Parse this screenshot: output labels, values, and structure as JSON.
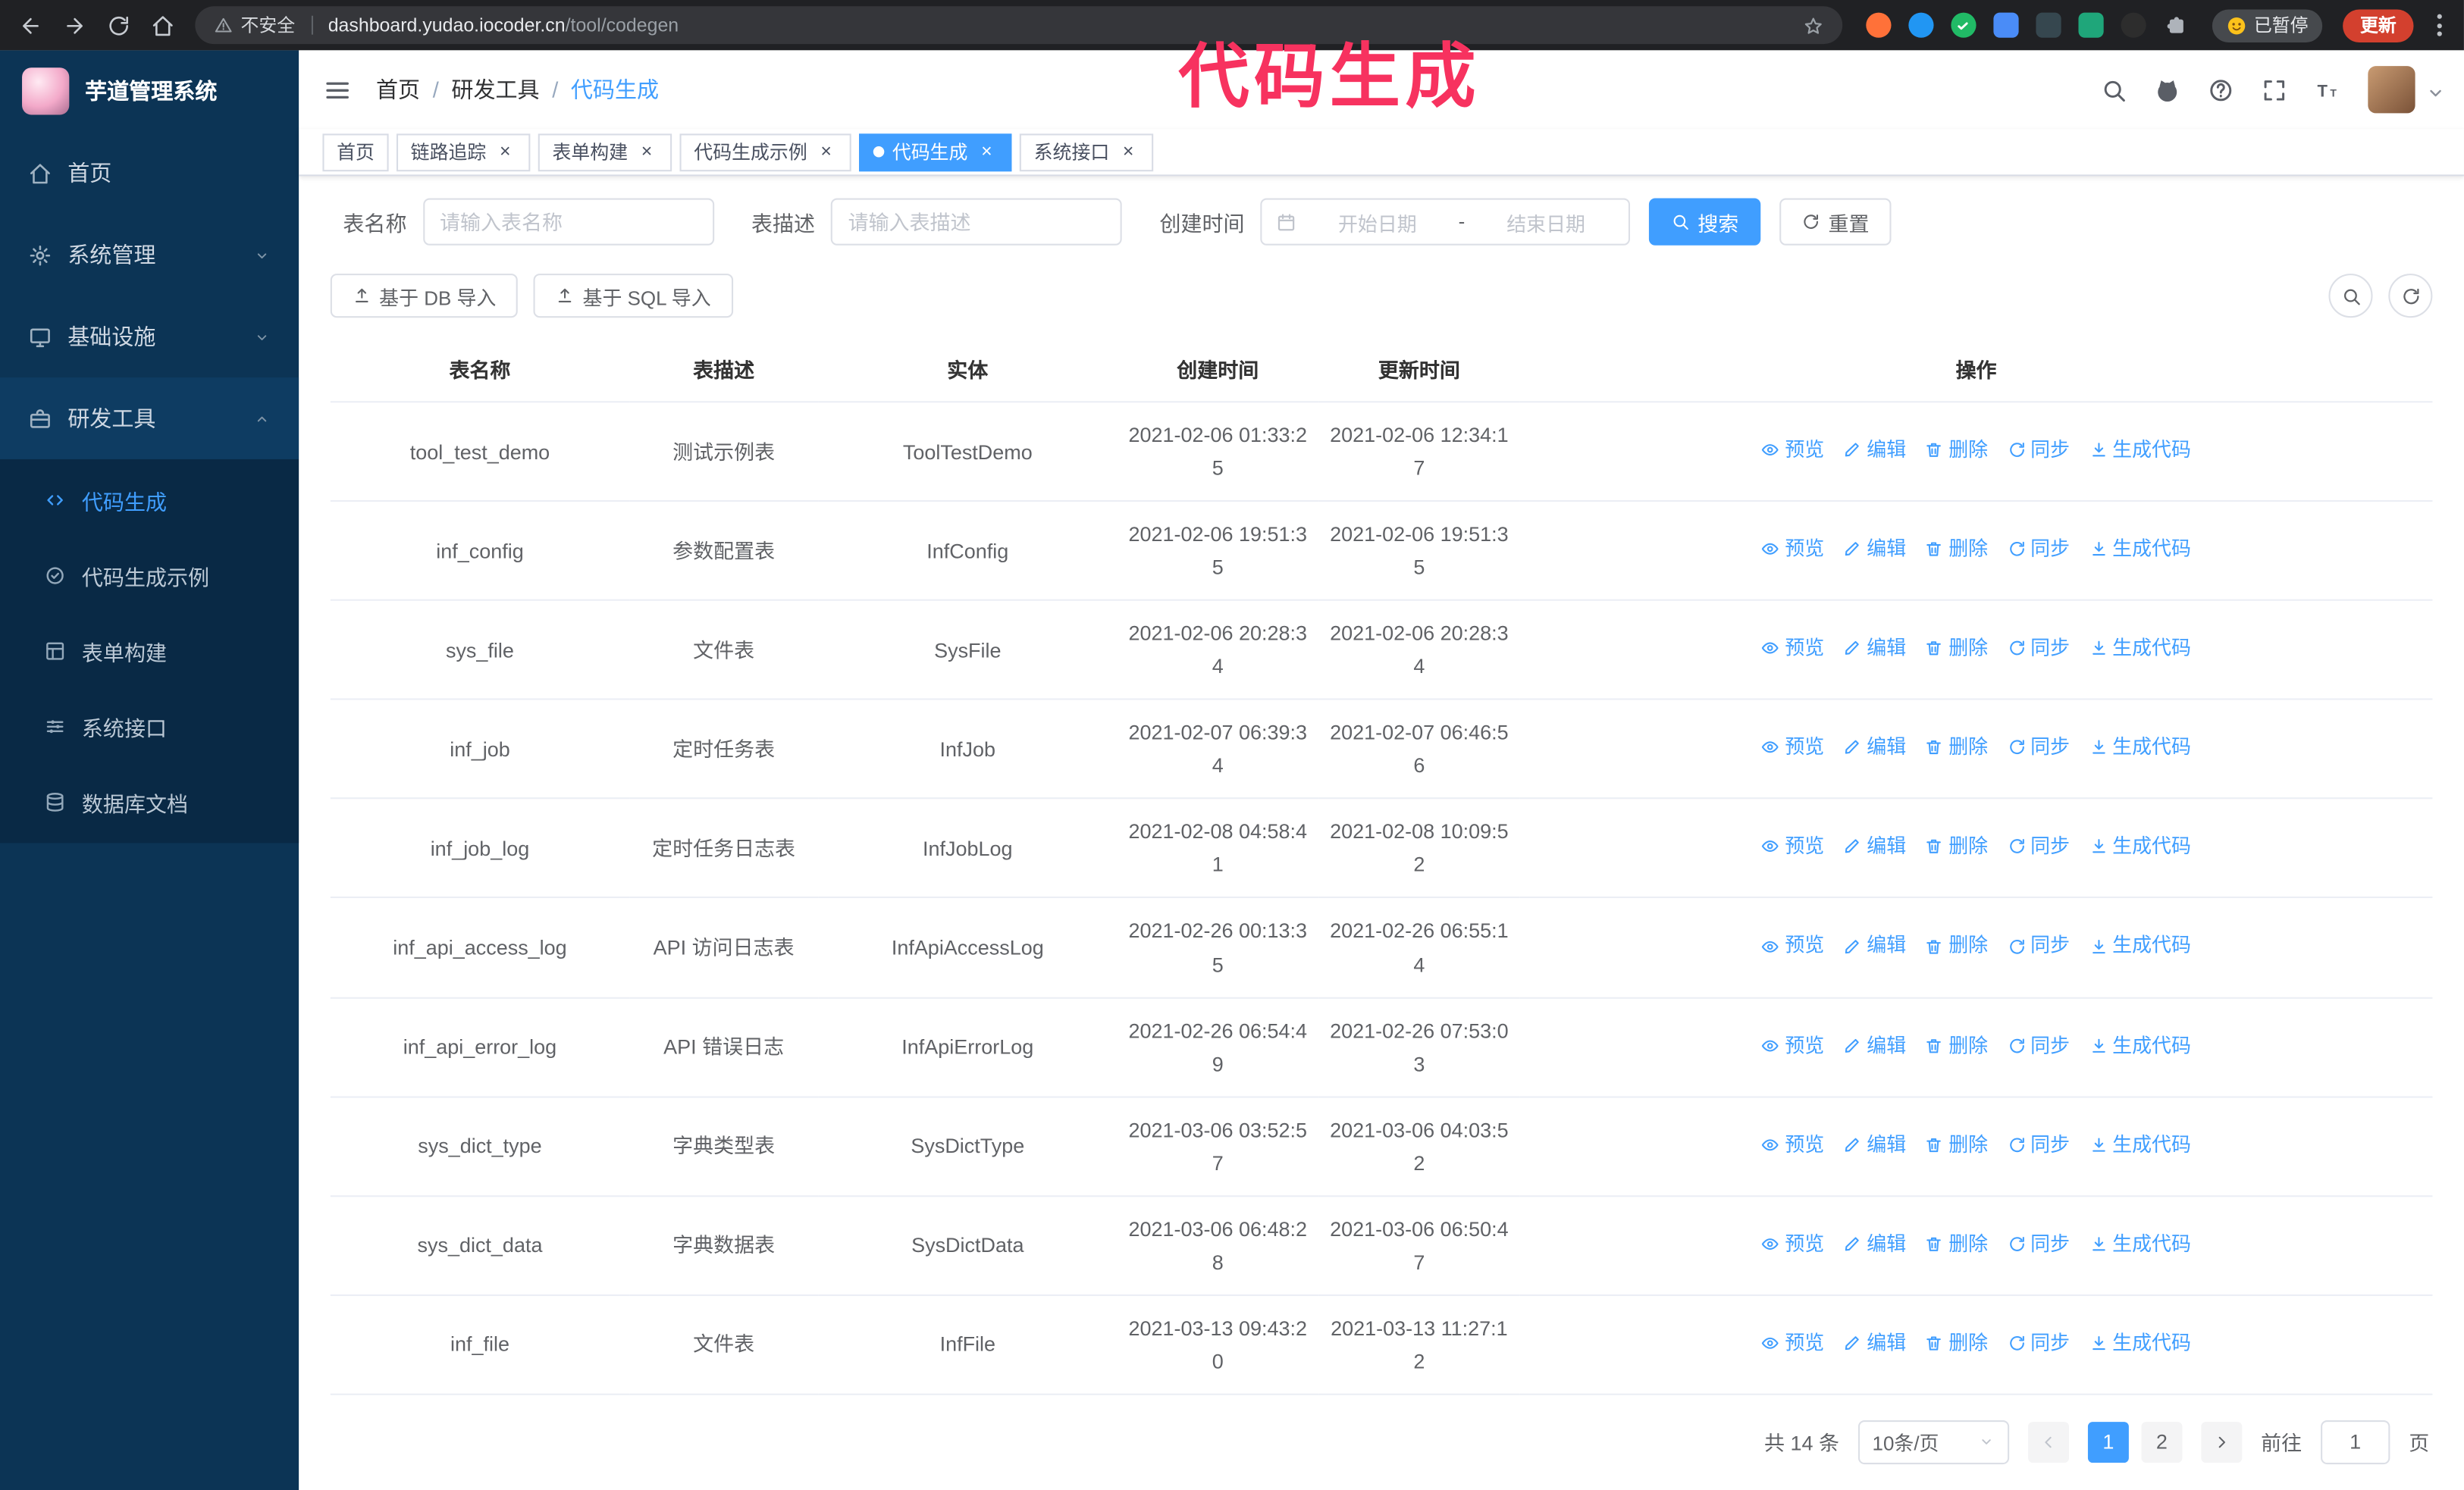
{
  "colors": {
    "accent": "#409eff",
    "annotation": "#f7325f",
    "update_button": "#d3402e",
    "sidebar_bg": "#0c3455",
    "sidebar_submenu_bg": "#092945",
    "sidebar_active_bg": "#0e3c62"
  },
  "annotation": {
    "text": "代码生成"
  },
  "browser": {
    "security_label": "不安全",
    "url_host": "dashboard.yudao.iocoder.cn",
    "url_path": "/tool/codegen",
    "paused_badge": "已暂停",
    "update_button": "更新",
    "extensions": [
      {
        "name": "fox",
        "color": "#ff7139",
        "shape": "circle"
      },
      {
        "name": "drop",
        "color": "#2196f3",
        "shape": "circle"
      },
      {
        "name": "verified",
        "color": "#21ba66",
        "shape": "circle"
      },
      {
        "name": "people",
        "color": "#4a8cf7",
        "shape": "square"
      },
      {
        "name": "shield",
        "color": "#36474f",
        "shape": "square"
      },
      {
        "name": "leaf",
        "color": "#1fa67a",
        "shape": "square"
      },
      {
        "name": "paw",
        "color": "#2d2d2d",
        "shape": "circle"
      },
      {
        "name": "puzzle",
        "color": "#aeb3ba",
        "shape": "puzzle"
      }
    ]
  },
  "sidebar": {
    "logo_title": "芋道管理系统",
    "menu": [
      {
        "id": "home",
        "icon": "home",
        "label": "首页",
        "has_children": false,
        "expanded": false
      },
      {
        "id": "system",
        "icon": "gear",
        "label": "系统管理",
        "has_children": true,
        "expanded": false
      },
      {
        "id": "infra",
        "icon": "monitor",
        "label": "基础设施",
        "has_children": true,
        "expanded": false
      },
      {
        "id": "dev-tools",
        "icon": "toolbox",
        "label": "研发工具",
        "has_children": true,
        "expanded": true,
        "children": [
          {
            "id": "codegen",
            "icon": "code",
            "label": "代码生成",
            "active": true
          },
          {
            "id": "codegen-example",
            "icon": "badge",
            "label": "代码生成示例",
            "active": false
          },
          {
            "id": "form-builder",
            "icon": "form",
            "label": "表单构建",
            "active": false
          },
          {
            "id": "system-api",
            "icon": "sliders",
            "label": "系统接口",
            "active": false
          },
          {
            "id": "db-doc",
            "icon": "database",
            "label": "数据库文档",
            "active": false
          }
        ]
      }
    ]
  },
  "navbar": {
    "icons": [
      "search",
      "github",
      "question",
      "fullscreen",
      "fontsize"
    ]
  },
  "breadcrumb": [
    "首页",
    "研发工具",
    "代码生成"
  ],
  "tabs": [
    {
      "id": "home",
      "label": "首页",
      "closable": false,
      "active": false
    },
    {
      "id": "trace",
      "label": "链路追踪",
      "closable": true,
      "active": false
    },
    {
      "id": "form-builder",
      "label": "表单构建",
      "closable": true,
      "active": false
    },
    {
      "id": "codegen-example",
      "label": "代码生成示例",
      "closable": true,
      "active": false
    },
    {
      "id": "codegen",
      "label": "代码生成",
      "closable": true,
      "active": true
    },
    {
      "id": "system-api",
      "label": "系统接口",
      "closable": true,
      "active": false
    }
  ],
  "filters": {
    "table_name_label": "表名称",
    "table_name_placeholder": "请输入表名称",
    "table_desc_label": "表描述",
    "table_desc_placeholder": "请输入表描述",
    "create_time_label": "创建时间",
    "date_start_placeholder": "开始日期",
    "date_separator": "-",
    "date_end_placeholder": "结束日期",
    "search_button": "搜索",
    "reset_button": "重置"
  },
  "toolbar": {
    "import_db": "基于 DB 导入",
    "import_sql": "基于 SQL 导入"
  },
  "table": {
    "columns": [
      "表名称",
      "表描述",
      "实体",
      "创建时间",
      "更新时间",
      "操作"
    ],
    "actions": [
      "预览",
      "编辑",
      "删除",
      "同步",
      "生成代码"
    ],
    "rows": [
      {
        "name": "tool_test_demo",
        "desc": "测试示例表",
        "entity": "ToolTestDemo",
        "created": "2021-02-06 01:33:25",
        "updated": "2021-02-06 12:34:17"
      },
      {
        "name": "inf_config",
        "desc": "参数配置表",
        "entity": "InfConfig",
        "created": "2021-02-06 19:51:35",
        "updated": "2021-02-06 19:51:35"
      },
      {
        "name": "sys_file",
        "desc": "文件表",
        "entity": "SysFile",
        "created": "2021-02-06 20:28:34",
        "updated": "2021-02-06 20:28:34"
      },
      {
        "name": "inf_job",
        "desc": "定时任务表",
        "entity": "InfJob",
        "created": "2021-02-07 06:39:34",
        "updated": "2021-02-07 06:46:56"
      },
      {
        "name": "inf_job_log",
        "desc": "定时任务日志表",
        "entity": "InfJobLog",
        "created": "2021-02-08 04:58:41",
        "updated": "2021-02-08 10:09:52"
      },
      {
        "name": "inf_api_access_log",
        "desc": "API 访问日志表",
        "entity": "InfApiAccessLog",
        "created": "2021-02-26 00:13:35",
        "updated": "2021-02-26 06:55:14"
      },
      {
        "name": "inf_api_error_log",
        "desc": "API 错误日志",
        "entity": "InfApiErrorLog",
        "created": "2021-02-26 06:54:49",
        "updated": "2021-02-26 07:53:03"
      },
      {
        "name": "sys_dict_type",
        "desc": "字典类型表",
        "entity": "SysDictType",
        "created": "2021-03-06 03:52:57",
        "updated": "2021-03-06 04:03:52"
      },
      {
        "name": "sys_dict_data",
        "desc": "字典数据表",
        "entity": "SysDictData",
        "created": "2021-03-06 06:48:28",
        "updated": "2021-03-06 06:50:47"
      },
      {
        "name": "inf_file",
        "desc": "文件表",
        "entity": "InfFile",
        "created": "2021-03-13 09:43:20",
        "updated": "2021-03-13 11:27:12"
      }
    ]
  },
  "pagination": {
    "total": "共 14 条",
    "page_size": "10条/页",
    "pages": [
      "1",
      "2"
    ],
    "active_page": "1",
    "goto_label": "前往",
    "goto_value": "1",
    "goto_suffix": "页"
  }
}
